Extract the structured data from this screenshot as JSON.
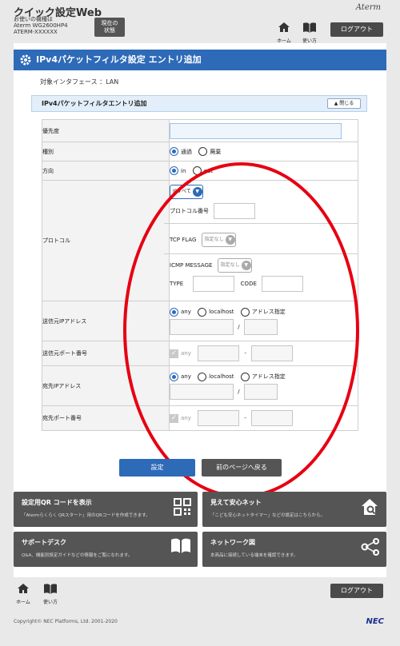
{
  "header": {
    "app_title": "クイック設定Web",
    "device_line1": "お使いの機種は",
    "device_line2": "Aterm WG2600HP4",
    "device_line3": "ATERM-XXXXXX",
    "state_line1": "現在の",
    "state_line2": "状態",
    "brand": "Aterm",
    "home_label": "ホーム",
    "help_label": "使い方",
    "logout_label": "ログアウト"
  },
  "page": {
    "title": "IPv4パケットフィルタ設定 エントリ追加",
    "interface_label": "対象インタフェース ：LAN",
    "section_title": "IPv4パケットフィルタエントリ追加",
    "close_label": "閉じる"
  },
  "form": {
    "priority_label": "優先度",
    "type_label": "種別",
    "type_opt1": "通過",
    "type_opt2": "廃棄",
    "direction_label": "方向",
    "dir_opt1": "in",
    "dir_opt2": "out",
    "protocol_label": "プロトコル",
    "protocol_select": "IPすべて",
    "protocol_no_label": "プロトコル番号",
    "tcp_flag_label": "TCP FLAG",
    "tcp_flag_select": "指定なし",
    "icmp_label": "ICMP MESSAGE",
    "icmp_select": "指定なし",
    "type_field_label": "TYPE",
    "code_field_label": "CODE",
    "src_ip_label": "送信元IPアドレス",
    "src_ip_any": "any",
    "src_ip_localhost": "localhost",
    "src_ip_spec": "アドレス指定",
    "slash": "/",
    "src_port_label": "送信元ポート番号",
    "src_port_any": "any",
    "dash": "-",
    "dst_ip_label": "宛先IPアドレス",
    "dst_ip_any": "any",
    "dst_ip_localhost": "localhost",
    "dst_ip_spec": "アドレス指定",
    "dst_port_label": "宛先ポート番号",
    "dst_port_any": "any"
  },
  "buttons": {
    "set": "設定",
    "back": "前のページへ戻る"
  },
  "tiles": [
    {
      "title": "設定用QR コードを表示",
      "desc": "「Atermらくらく QRスタート」用のQRコードを作成できます。"
    },
    {
      "title": "見えて安心ネット",
      "desc": "「こども安心ネットタイマー」などの設定はこちらから。"
    },
    {
      "title": "サポートデスク",
      "desc": "Q&A、機能別設定ガイドなどの情報をご覧になれます。"
    },
    {
      "title": "ネットワーク図",
      "desc": "本商品に接続している端末を確認できます。"
    }
  ],
  "footer": {
    "home_label": "ホーム",
    "help_label": "使い方",
    "logout_label": "ログアウト",
    "copyright": "Copyright© NEC Platforms, Ltd. 2001-2020",
    "nec": "NEC"
  },
  "colors": {
    "accent": "#2d6ab8",
    "highlight": "#e60012",
    "tile": "#555555"
  }
}
